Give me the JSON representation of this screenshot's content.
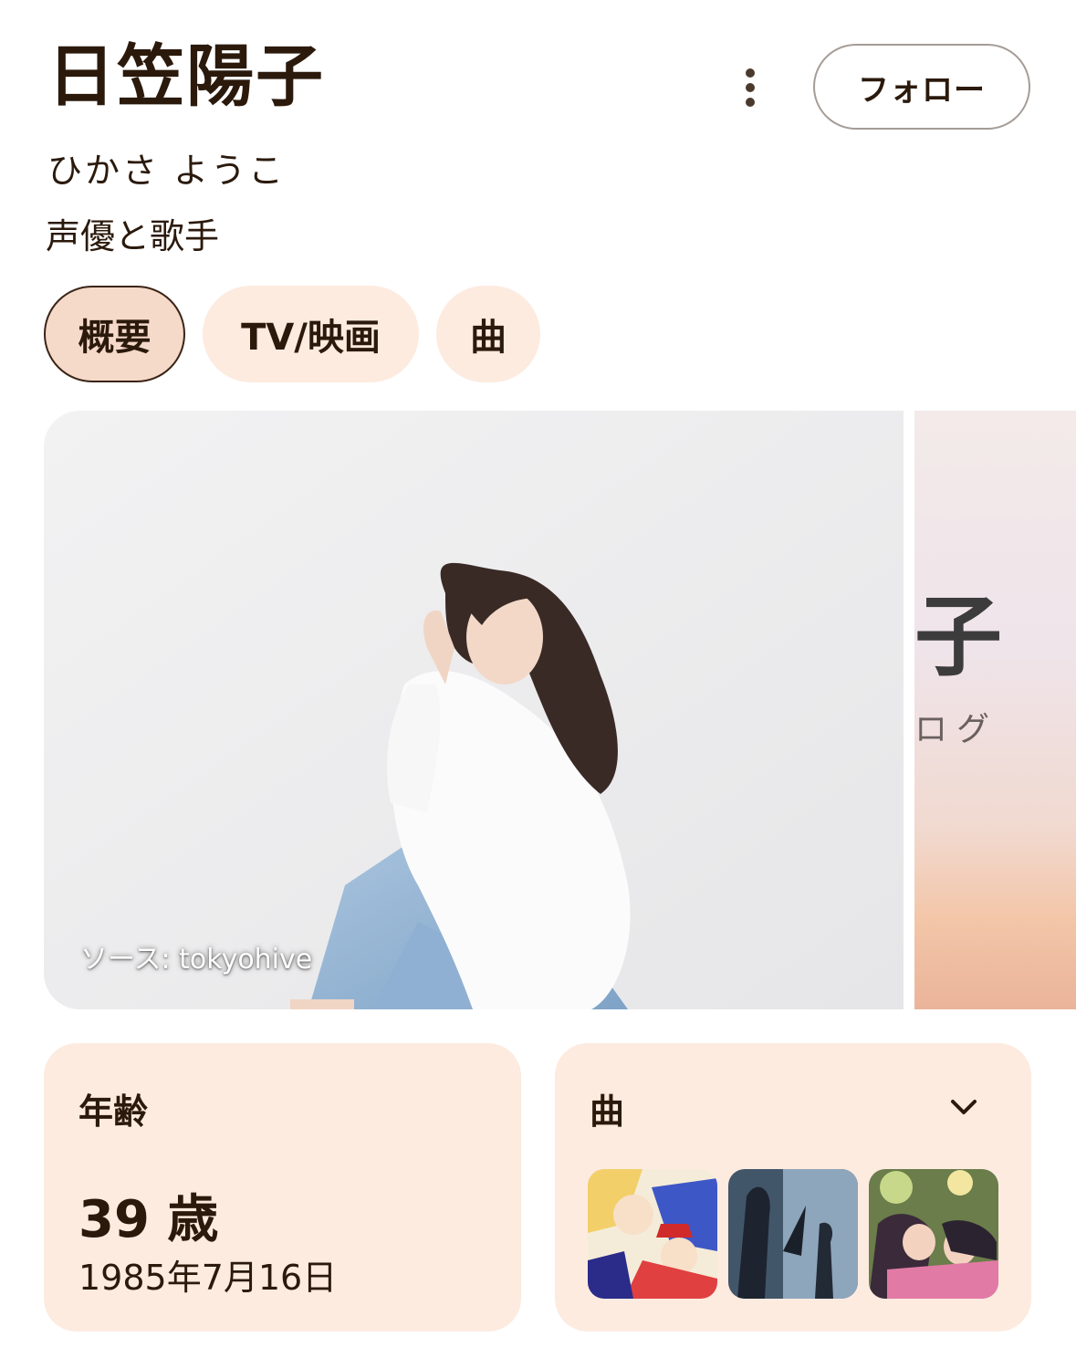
{
  "header": {
    "title": "日笠陽子",
    "reading": "ひかさ ようこ",
    "role": "声優と歌手",
    "follow_label": "フォロー",
    "more_icon": "more-vert-icon"
  },
  "tabs": [
    {
      "label": "概要",
      "active": true
    },
    {
      "label": "TV/映画",
      "active": false
    },
    {
      "label": "曲",
      "active": false
    }
  ],
  "gallery": {
    "source_label": "ソース: tokyohive",
    "side_text_big": "子",
    "side_text_small": "ログ"
  },
  "age_card": {
    "label": "年齢",
    "value": "39 歳",
    "birth_date": "1985年7月16日"
  },
  "songs_card": {
    "label": "曲",
    "expand_icon": "chevron-down-icon",
    "thumbnail_count": 3
  },
  "colors": {
    "chip_bg": "#fdebe0",
    "chip_active_bg": "#f5d9c9",
    "card_bg": "#fdebe0",
    "text": "#2b1a0c"
  }
}
